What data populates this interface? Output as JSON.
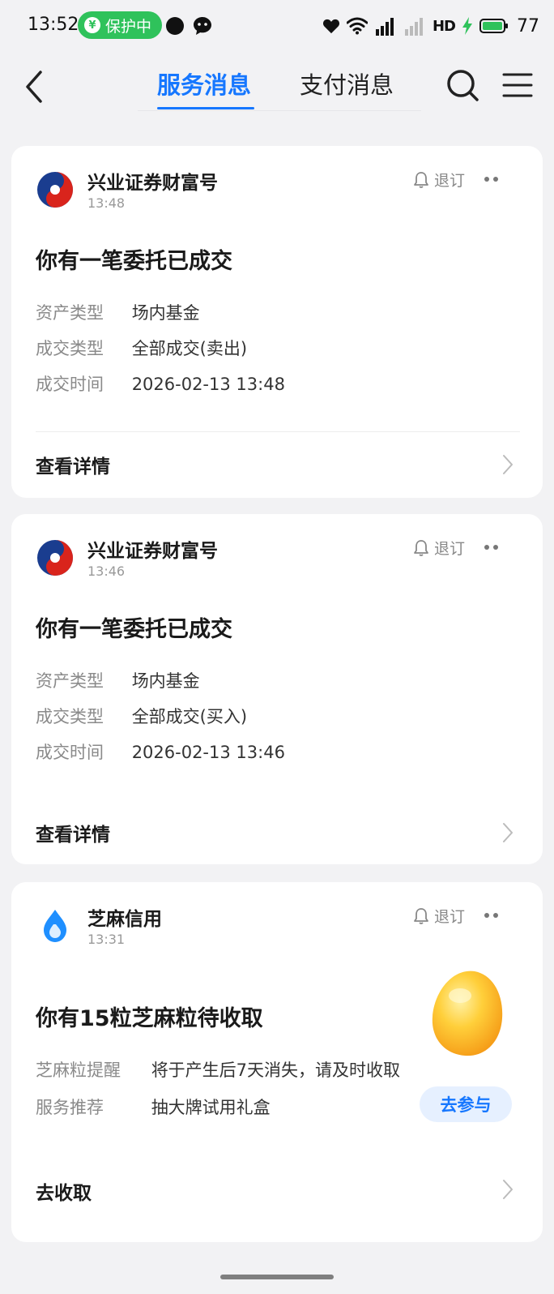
{
  "status_bar": {
    "time": "13:52",
    "protect_label": "保护中",
    "network_label": "HD",
    "battery": "77",
    "icons": [
      "shield-icon",
      "app-dot-icon",
      "chat-bubble-icon",
      "heart-icon",
      "wifi-icon",
      "signal-5g-icon",
      "signal-icon",
      "charging-icon",
      "battery-icon"
    ]
  },
  "header": {
    "tabs": [
      {
        "label": "服务消息",
        "active": true
      },
      {
        "label": "支付消息",
        "active": false
      }
    ],
    "accent": "#1677ff"
  },
  "cards": [
    {
      "sender": "兴业证券财富号",
      "time": "13:48",
      "unsubscribe": "退订",
      "headline": "你有一笔委托已成交",
      "rows": [
        {
          "k": "资产类型",
          "v": "场内基金"
        },
        {
          "k": "成交类型",
          "v": "全部成交(卖出)"
        },
        {
          "k": "成交时间",
          "v": "2026-02-13 13:48"
        }
      ],
      "action": "查看详情"
    },
    {
      "sender": "兴业证券财富号",
      "time": "13:46",
      "unsubscribe": "退订",
      "headline": "你有一笔委托已成交",
      "rows": [
        {
          "k": "资产类型",
          "v": "场内基金"
        },
        {
          "k": "成交类型",
          "v": "全部成交(买入)"
        },
        {
          "k": "成交时间",
          "v": "2026-02-13 13:46"
        }
      ],
      "action": "查看详情"
    },
    {
      "sender": "芝麻信用",
      "time": "13:31",
      "unsubscribe": "退订",
      "headline": "你有15粒芝麻粒待收取",
      "reminder_key": "芝麻粒提醒",
      "reminder_value": "将于产生后7天消失，请及时收取",
      "recommend_key": "服务推荐",
      "recommend_link": "抽大牌试用礼盒",
      "join_label": "去参与",
      "action": "去收取"
    }
  ]
}
